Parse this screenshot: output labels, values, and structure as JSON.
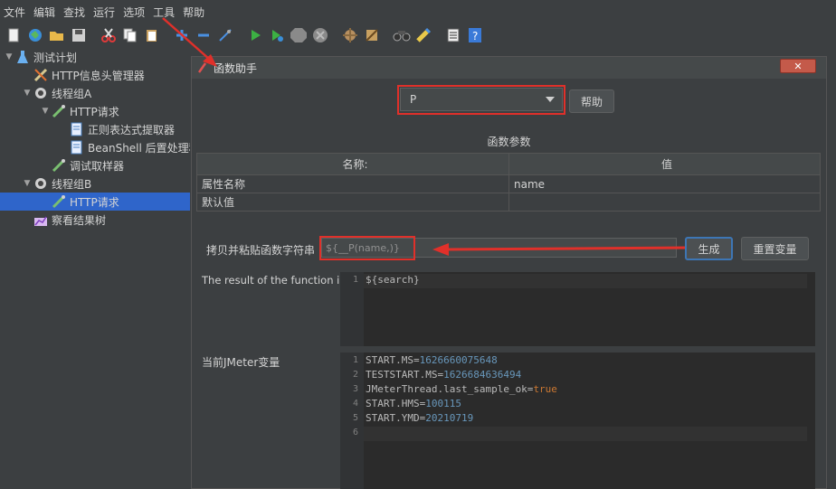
{
  "menu": [
    "文件",
    "编辑",
    "查找",
    "运行",
    "选项",
    "工具",
    "帮助"
  ],
  "toolbar_icons": [
    "new-icon",
    "templates-icon",
    "open-icon",
    "save-icon",
    "cut-icon",
    "copy-icon",
    "paste-icon",
    "expand-icon",
    "collapse-icon",
    "toggle-icon",
    "start-icon",
    "start-no-pause-icon",
    "stop-icon",
    "shutdown-icon",
    "clear-icon",
    "clear-all-icon",
    "search-icon",
    "reset-search-icon",
    "function-helper-icon",
    "help-icon"
  ],
  "tree": {
    "test_plan": "测试计划",
    "header_manager": "HTTP信息头管理器",
    "thread_group_a": "线程组A",
    "http_request_a": "HTTP请求",
    "regex_extractor": "正则表达式提取器",
    "beanshell_post": "BeanShell 后置处理程",
    "debug_sampler": "调试取样器",
    "thread_group_b": "线程组B",
    "http_request_b": "HTTP请求",
    "result_tree": "察看结果树"
  },
  "dialog": {
    "title": "函数助手",
    "close_label": "✕",
    "function_selected": "P",
    "help_button": "帮助",
    "params_title": "函数参数",
    "col_name": "名称:",
    "col_value": "值",
    "rows": [
      {
        "name": "属性名称",
        "value": "name"
      },
      {
        "name": "默认值",
        "value": ""
      }
    ],
    "copy_label": "拷贝并粘贴函数字符串",
    "function_string": "${__P(name,)}",
    "generate_button": "生成",
    "reset_button": "重置变量",
    "result_label": "The result of the function is",
    "result_lines": [
      "${search}"
    ],
    "vars_label": "当前JMeter变量",
    "vars_lines": [
      {
        "key": "START.MS=",
        "val": "1626660075648",
        "type": "num"
      },
      {
        "key": "TESTSTART.MS=",
        "val": "1626684636494",
        "type": "num"
      },
      {
        "key": "JMeterThread.last_sample_ok=",
        "val": "true",
        "type": "kw"
      },
      {
        "key": "START.HMS=",
        "val": "100115",
        "type": "num"
      },
      {
        "key": "START.YMD=",
        "val": "20210719",
        "type": "num"
      },
      {
        "key": "",
        "val": "",
        "type": "num"
      }
    ]
  },
  "colors": {
    "highlight_red": "#e0302a",
    "selection_blue": "#2f65ca"
  }
}
